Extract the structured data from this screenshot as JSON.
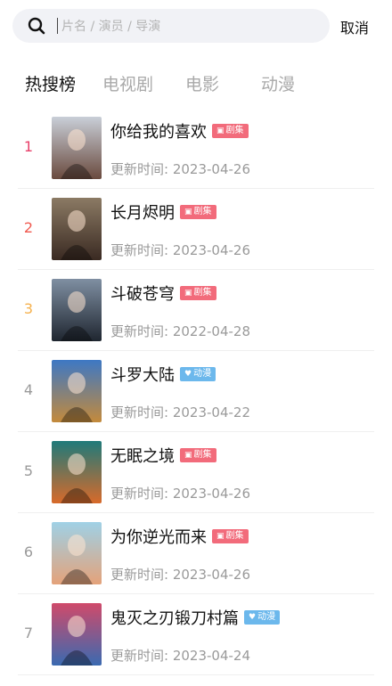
{
  "search": {
    "placeholder": "片名 / 演员 / 导演",
    "value": ""
  },
  "cancel_label": "取消",
  "tabs": [
    {
      "label": "热搜榜",
      "active": true
    },
    {
      "label": "电视剧",
      "active": false
    },
    {
      "label": "电影",
      "active": false
    },
    {
      "label": "动漫",
      "active": false
    }
  ],
  "update_prefix": "更新时间: ",
  "rank_colors": [
    "#e8406a",
    "#f0594f",
    "#f5b14d",
    "#9a9a9a",
    "#9a9a9a",
    "#9a9a9a",
    "#9a9a9a"
  ],
  "badge_colors": {
    "drama": "#f26b7b",
    "anime": "#6cb8ec"
  },
  "items": [
    {
      "rank": "1",
      "title": "你给我的喜欢",
      "badge": "剧集",
      "badge_type": "drama",
      "date": "2023-04-26",
      "poster_colors": [
        "#c9cfd8",
        "#6a4a3e"
      ]
    },
    {
      "rank": "2",
      "title": "长月烬明",
      "badge": "剧集",
      "badge_type": "drama",
      "date": "2023-04-26",
      "poster_colors": [
        "#8b7a64",
        "#3a2a22"
      ]
    },
    {
      "rank": "3",
      "title": "斗破苍穹",
      "badge": "剧集",
      "badge_type": "drama",
      "date": "2022-04-28",
      "poster_colors": [
        "#7f8fa2",
        "#1f2630"
      ]
    },
    {
      "rank": "4",
      "title": "斗罗大陆",
      "badge": "动漫",
      "badge_type": "anime",
      "date": "2023-04-22",
      "poster_colors": [
        "#3d78c4",
        "#c48a3b"
      ]
    },
    {
      "rank": "5",
      "title": "无眠之境",
      "badge": "剧集",
      "badge_type": "drama",
      "date": "2023-04-26",
      "poster_colors": [
        "#1f7a7a",
        "#d86a2a"
      ]
    },
    {
      "rank": "6",
      "title": "为你逆光而来",
      "badge": "剧集",
      "badge_type": "drama",
      "date": "2023-04-26",
      "poster_colors": [
        "#9fd1e6",
        "#e4a27a"
      ]
    },
    {
      "rank": "7",
      "title": "鬼灭之刃锻刀村篇",
      "badge": "动漫",
      "badge_type": "anime",
      "date": "2023-04-24",
      "poster_colors": [
        "#d04a6a",
        "#3a6ab0"
      ]
    }
  ]
}
